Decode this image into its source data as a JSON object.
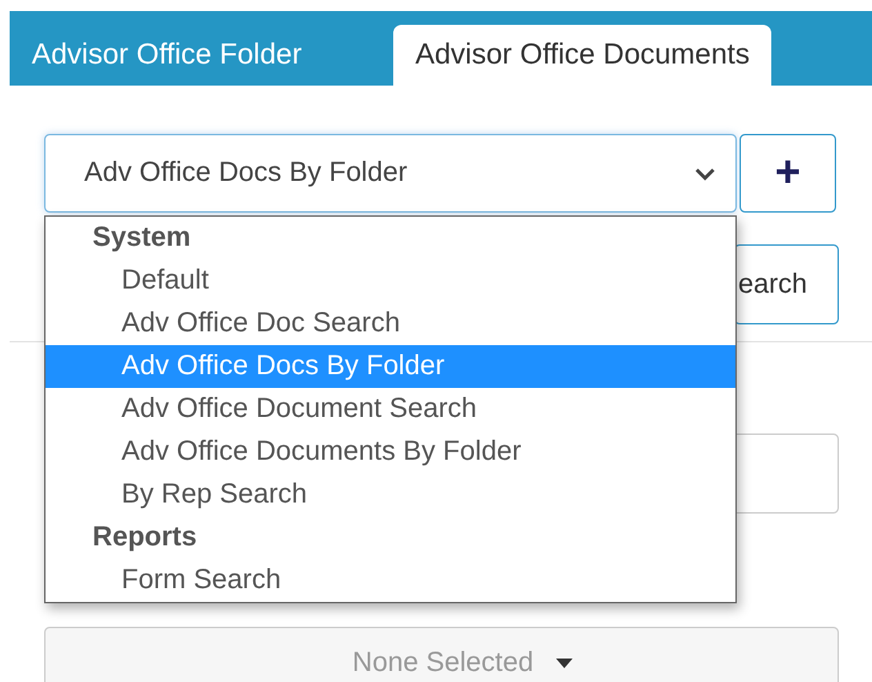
{
  "tabs": [
    {
      "label": "Advisor Office Folder",
      "selected": false
    },
    {
      "label": "Advisor Office Documents",
      "selected": true
    }
  ],
  "view_select": {
    "value": "Adv Office Docs By Folder",
    "expanded": true
  },
  "add_button": {
    "label": "+"
  },
  "dropdown": {
    "groups": [
      {
        "label": "System",
        "options": [
          {
            "label": "Default",
            "selected": false
          },
          {
            "label": "Adv Office Doc Search",
            "selected": false
          },
          {
            "label": "Adv Office Docs By Folder",
            "selected": true
          },
          {
            "label": "Adv Office Document Search",
            "selected": false
          },
          {
            "label": "Adv Office Documents By Folder",
            "selected": false
          },
          {
            "label": "By Rep Search",
            "selected": false
          }
        ]
      },
      {
        "label": "Reports",
        "options": [
          {
            "label": "Form Search",
            "selected": false
          }
        ]
      }
    ]
  },
  "search_button": {
    "label": "earch"
  },
  "multiselect": {
    "label": "None Selected"
  }
}
